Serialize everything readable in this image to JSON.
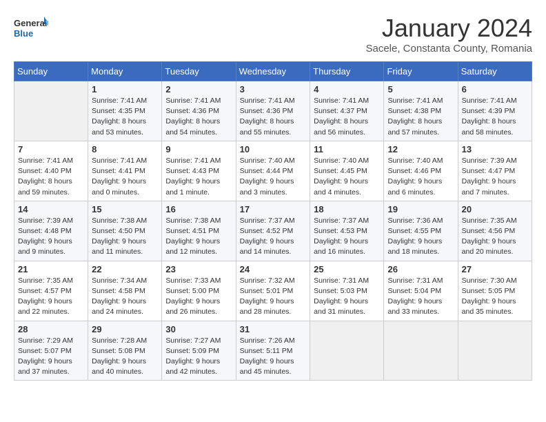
{
  "header": {
    "logo_general": "General",
    "logo_blue": "Blue",
    "month": "January 2024",
    "location": "Sacele, Constanta County, Romania"
  },
  "weekdays": [
    "Sunday",
    "Monday",
    "Tuesday",
    "Wednesday",
    "Thursday",
    "Friday",
    "Saturday"
  ],
  "weeks": [
    [
      {
        "day": "",
        "info": ""
      },
      {
        "day": "1",
        "info": "Sunrise: 7:41 AM\nSunset: 4:35 PM\nDaylight: 8 hours\nand 53 minutes."
      },
      {
        "day": "2",
        "info": "Sunrise: 7:41 AM\nSunset: 4:36 PM\nDaylight: 8 hours\nand 54 minutes."
      },
      {
        "day": "3",
        "info": "Sunrise: 7:41 AM\nSunset: 4:36 PM\nDaylight: 8 hours\nand 55 minutes."
      },
      {
        "day": "4",
        "info": "Sunrise: 7:41 AM\nSunset: 4:37 PM\nDaylight: 8 hours\nand 56 minutes."
      },
      {
        "day": "5",
        "info": "Sunrise: 7:41 AM\nSunset: 4:38 PM\nDaylight: 8 hours\nand 57 minutes."
      },
      {
        "day": "6",
        "info": "Sunrise: 7:41 AM\nSunset: 4:39 PM\nDaylight: 8 hours\nand 58 minutes."
      }
    ],
    [
      {
        "day": "7",
        "info": "Sunrise: 7:41 AM\nSunset: 4:40 PM\nDaylight: 8 hours\nand 59 minutes."
      },
      {
        "day": "8",
        "info": "Sunrise: 7:41 AM\nSunset: 4:41 PM\nDaylight: 9 hours\nand 0 minutes."
      },
      {
        "day": "9",
        "info": "Sunrise: 7:41 AM\nSunset: 4:43 PM\nDaylight: 9 hours\nand 1 minute."
      },
      {
        "day": "10",
        "info": "Sunrise: 7:40 AM\nSunset: 4:44 PM\nDaylight: 9 hours\nand 3 minutes."
      },
      {
        "day": "11",
        "info": "Sunrise: 7:40 AM\nSunset: 4:45 PM\nDaylight: 9 hours\nand 4 minutes."
      },
      {
        "day": "12",
        "info": "Sunrise: 7:40 AM\nSunset: 4:46 PM\nDaylight: 9 hours\nand 6 minutes."
      },
      {
        "day": "13",
        "info": "Sunrise: 7:39 AM\nSunset: 4:47 PM\nDaylight: 9 hours\nand 7 minutes."
      }
    ],
    [
      {
        "day": "14",
        "info": "Sunrise: 7:39 AM\nSunset: 4:48 PM\nDaylight: 9 hours\nand 9 minutes."
      },
      {
        "day": "15",
        "info": "Sunrise: 7:38 AM\nSunset: 4:50 PM\nDaylight: 9 hours\nand 11 minutes."
      },
      {
        "day": "16",
        "info": "Sunrise: 7:38 AM\nSunset: 4:51 PM\nDaylight: 9 hours\nand 12 minutes."
      },
      {
        "day": "17",
        "info": "Sunrise: 7:37 AM\nSunset: 4:52 PM\nDaylight: 9 hours\nand 14 minutes."
      },
      {
        "day": "18",
        "info": "Sunrise: 7:37 AM\nSunset: 4:53 PM\nDaylight: 9 hours\nand 16 minutes."
      },
      {
        "day": "19",
        "info": "Sunrise: 7:36 AM\nSunset: 4:55 PM\nDaylight: 9 hours\nand 18 minutes."
      },
      {
        "day": "20",
        "info": "Sunrise: 7:35 AM\nSunset: 4:56 PM\nDaylight: 9 hours\nand 20 minutes."
      }
    ],
    [
      {
        "day": "21",
        "info": "Sunrise: 7:35 AM\nSunset: 4:57 PM\nDaylight: 9 hours\nand 22 minutes."
      },
      {
        "day": "22",
        "info": "Sunrise: 7:34 AM\nSunset: 4:58 PM\nDaylight: 9 hours\nand 24 minutes."
      },
      {
        "day": "23",
        "info": "Sunrise: 7:33 AM\nSunset: 5:00 PM\nDaylight: 9 hours\nand 26 minutes."
      },
      {
        "day": "24",
        "info": "Sunrise: 7:32 AM\nSunset: 5:01 PM\nDaylight: 9 hours\nand 28 minutes."
      },
      {
        "day": "25",
        "info": "Sunrise: 7:31 AM\nSunset: 5:03 PM\nDaylight: 9 hours\nand 31 minutes."
      },
      {
        "day": "26",
        "info": "Sunrise: 7:31 AM\nSunset: 5:04 PM\nDaylight: 9 hours\nand 33 minutes."
      },
      {
        "day": "27",
        "info": "Sunrise: 7:30 AM\nSunset: 5:05 PM\nDaylight: 9 hours\nand 35 minutes."
      }
    ],
    [
      {
        "day": "28",
        "info": "Sunrise: 7:29 AM\nSunset: 5:07 PM\nDaylight: 9 hours\nand 37 minutes."
      },
      {
        "day": "29",
        "info": "Sunrise: 7:28 AM\nSunset: 5:08 PM\nDaylight: 9 hours\nand 40 minutes."
      },
      {
        "day": "30",
        "info": "Sunrise: 7:27 AM\nSunset: 5:09 PM\nDaylight: 9 hours\nand 42 minutes."
      },
      {
        "day": "31",
        "info": "Sunrise: 7:26 AM\nSunset: 5:11 PM\nDaylight: 9 hours\nand 45 minutes."
      },
      {
        "day": "",
        "info": ""
      },
      {
        "day": "",
        "info": ""
      },
      {
        "day": "",
        "info": ""
      }
    ]
  ]
}
